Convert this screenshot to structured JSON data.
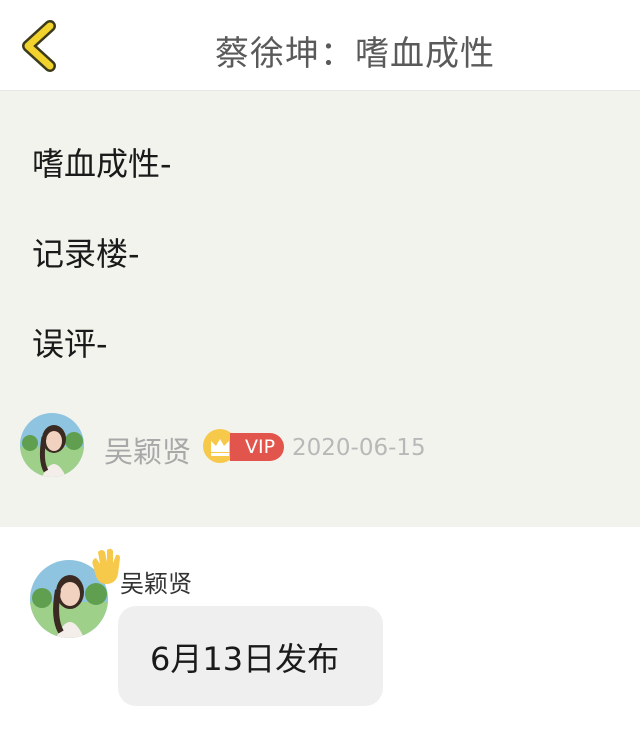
{
  "header": {
    "title": "蔡徐坤：嗜血成性",
    "back_icon": "chevron-left-icon",
    "accent_color": "#f2d22c"
  },
  "post": {
    "lines": [
      "嗜血成性-",
      "记录楼-",
      "误评-"
    ],
    "author": {
      "name": "吴颖贤",
      "badge_icon": "crown-icon",
      "vip_label": "VIP",
      "date": "2020-06-15"
    }
  },
  "comment": {
    "author": "吴颖贤",
    "text": "6月13日发布",
    "hand_icon": "waving-hand-icon"
  }
}
